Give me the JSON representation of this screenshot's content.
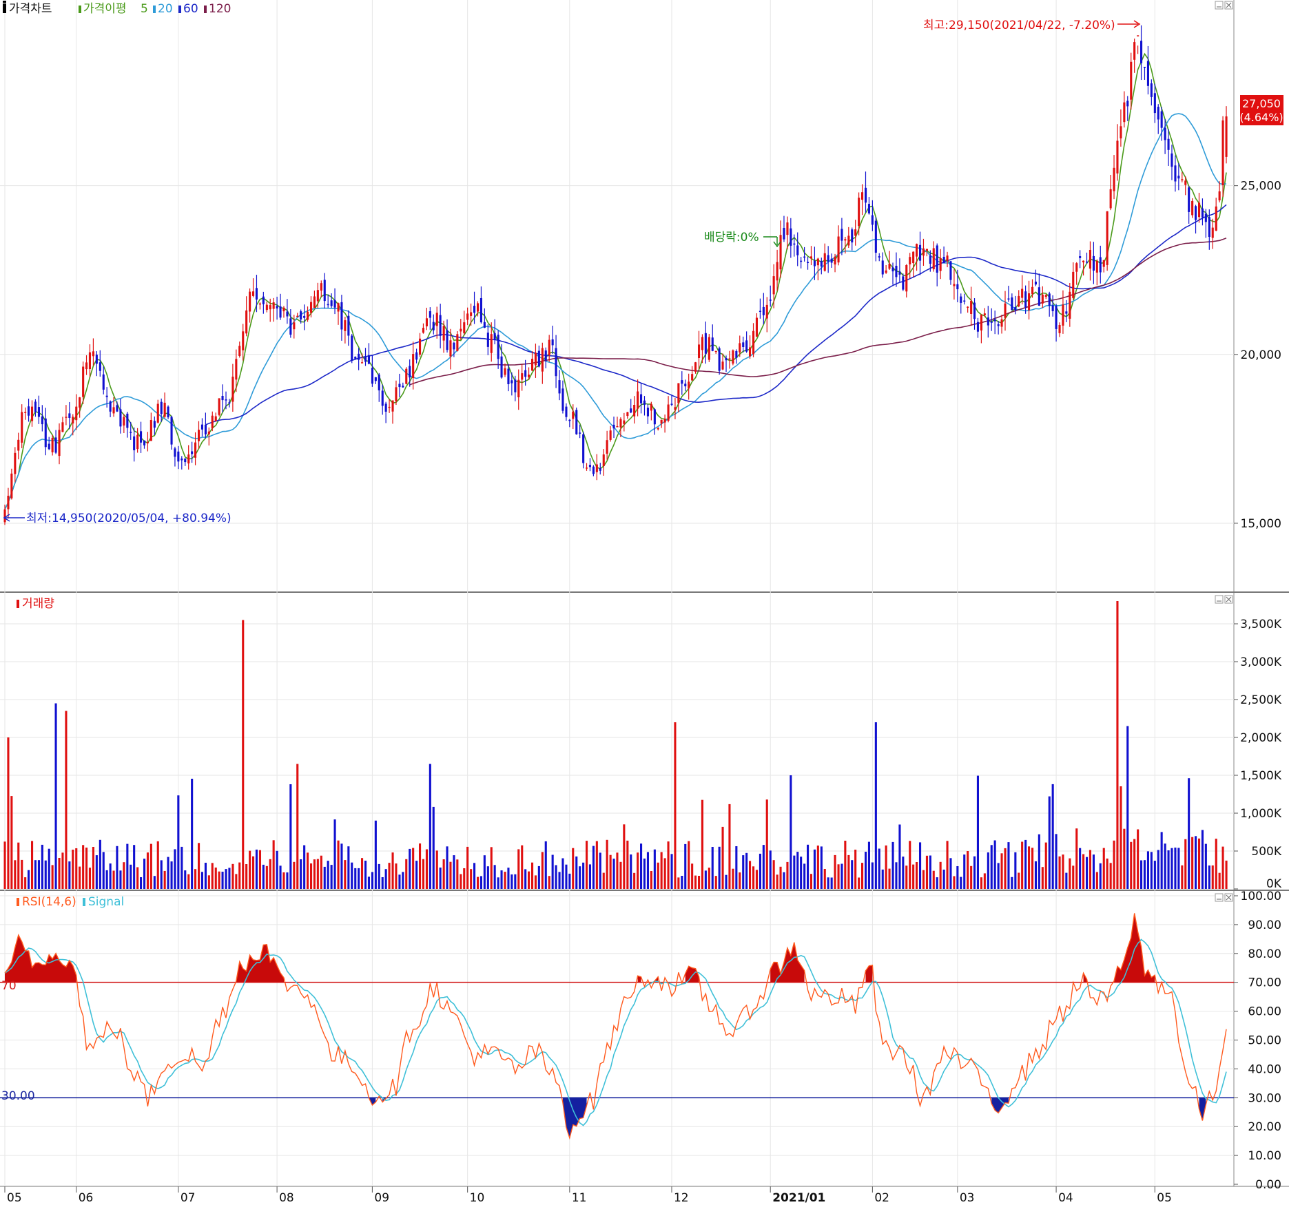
{
  "price_panel": {
    "legend": {
      "title": "가격차트",
      "ma_label": "가격이평",
      "ma_periods": [
        "5",
        "20",
        "60",
        "120"
      ],
      "ma_colors": [
        "#4a9a1a",
        "#2e9bd8",
        "#1c28c8",
        "#7b1e4a"
      ]
    },
    "y_ticks": [
      "15,000",
      "20,000",
      "25,000"
    ],
    "current_price": "27,050",
    "current_change": "(4.64%)",
    "high_annotation": "최고:29,150(2021/04/22, -7.20%)",
    "low_annotation": "최저:14,950(2020/05/04, +80.94%)",
    "dividend_annotation": "배당락:0%",
    "colors": {
      "up": "#e01010",
      "down": "#1010d0"
    }
  },
  "volume_panel": {
    "legend": "거래량",
    "y_ticks": [
      "0K",
      "500K",
      "1,000K",
      "1,500K",
      "2,000K",
      "2,500K",
      "3,000K",
      "3,500K"
    ]
  },
  "rsi_panel": {
    "legend_rsi": "RSI(14,6)",
    "legend_signal": "Signal",
    "y_ticks": [
      "0.00",
      "10.00",
      "20.00",
      "30.00",
      "40.00",
      "50.00",
      "60.00",
      "70.00",
      "80.00",
      "90.00",
      "100.00"
    ],
    "upper_level_label": "70",
    "lower_level_label": "30.00",
    "colors": {
      "rsi": "#ff5a1e",
      "signal": "#3fc0d8",
      "upper": "#d21a1a",
      "lower": "#1c28a0"
    }
  },
  "x_axis": {
    "labels": [
      "05",
      "06",
      "07",
      "08",
      "09",
      "10",
      "11",
      "12",
      "2021/01",
      "02",
      "03",
      "04",
      "05"
    ]
  },
  "chart_data": [
    {
      "type": "candlestick",
      "title": "가격차트",
      "x_months": [
        "2020/05",
        "2020/06",
        "2020/07",
        "2020/08",
        "2020/09",
        "2020/10",
        "2020/11",
        "2020/12",
        "2021/01",
        "2021/02",
        "2021/03",
        "2021/04",
        "2021/05"
      ],
      "ylim": [
        13000,
        30500
      ],
      "control_points_close": [
        [
          0,
          15500
        ],
        [
          6,
          18400
        ],
        [
          14,
          17300
        ],
        [
          20,
          18400
        ],
        [
          25,
          20200
        ],
        [
          32,
          18200
        ],
        [
          40,
          17300
        ],
        [
          46,
          18400
        ],
        [
          52,
          16800
        ],
        [
          58,
          17600
        ],
        [
          66,
          18800
        ],
        [
          72,
          21700
        ],
        [
          78,
          21500
        ],
        [
          85,
          20800
        ],
        [
          92,
          21800
        ],
        [
          98,
          21200
        ],
        [
          104,
          19800
        ],
        [
          112,
          18600
        ],
        [
          118,
          19400
        ],
        [
          125,
          21100
        ],
        [
          131,
          20300
        ],
        [
          137,
          21500
        ],
        [
          143,
          20300
        ],
        [
          149,
          19000
        ],
        [
          154,
          19700
        ],
        [
          160,
          20200
        ],
        [
          166,
          18100
        ],
        [
          173,
          16400
        ],
        [
          180,
          17900
        ],
        [
          186,
          18600
        ],
        [
          193,
          18100
        ],
        [
          199,
          19000
        ],
        [
          205,
          20400
        ],
        [
          211,
          19800
        ],
        [
          217,
          20200
        ],
        [
          223,
          21400
        ],
        [
          229,
          23700
        ],
        [
          235,
          22600
        ],
        [
          241,
          22700
        ],
        [
          247,
          23300
        ],
        [
          252,
          24500
        ],
        [
          258,
          22500
        ],
        [
          264,
          22300
        ],
        [
          270,
          23100
        ],
        [
          276,
          22700
        ],
        [
          282,
          21600
        ],
        [
          286,
          20900
        ],
        [
          292,
          21000
        ],
        [
          298,
          21600
        ],
        [
          304,
          21700
        ],
        [
          310,
          21000
        ],
        [
          316,
          23000
        ],
        [
          322,
          22800
        ],
        [
          328,
          27000
        ],
        [
          333,
          29150
        ],
        [
          339,
          27300
        ],
        [
          345,
          25000
        ],
        [
          350,
          24200
        ],
        [
          355,
          23400
        ],
        [
          359,
          27050
        ]
      ],
      "ma_series": [
        "MA5",
        "MA20",
        "MA60",
        "MA120"
      ],
      "last_close": 27050,
      "high": {
        "date": "2021/04/22",
        "value": 29150
      },
      "low": {
        "date": "2020/05/04",
        "value": 14950
      }
    },
    {
      "type": "bar",
      "title": "거래량",
      "ylim": [
        0,
        3900000
      ],
      "spikes": [
        [
          1,
          2000000
        ],
        [
          15,
          2450000
        ],
        [
          18,
          2350000
        ],
        [
          70,
          3550000
        ],
        [
          86,
          1650000
        ],
        [
          125,
          1650000
        ],
        [
          197,
          2200000
        ],
        [
          231,
          1500000
        ],
        [
          256,
          2200000
        ],
        [
          327,
          3800000
        ],
        [
          330,
          2150000
        ]
      ]
    },
    {
      "type": "line",
      "title": "RSI(14,6)",
      "ylim": [
        0,
        100
      ],
      "levels": [
        70,
        30
      ],
      "control_points": [
        [
          0,
          70
        ],
        [
          4,
          83
        ],
        [
          10,
          76
        ],
        [
          15,
          82
        ],
        [
          20,
          75
        ],
        [
          25,
          47
        ],
        [
          32,
          55
        ],
        [
          38,
          38
        ],
        [
          42,
          30
        ],
        [
          48,
          43
        ],
        [
          54,
          45
        ],
        [
          58,
          40
        ],
        [
          64,
          60
        ],
        [
          70,
          77
        ],
        [
          76,
          82
        ],
        [
          82,
          70
        ],
        [
          90,
          65
        ],
        [
          96,
          45
        ],
        [
          103,
          41
        ],
        [
          108,
          30
        ],
        [
          114,
          33
        ],
        [
          120,
          55
        ],
        [
          126,
          68
        ],
        [
          132,
          58
        ],
        [
          138,
          45
        ],
        [
          144,
          45
        ],
        [
          150,
          40
        ],
        [
          156,
          46
        ],
        [
          162,
          36
        ],
        [
          166,
          20
        ],
        [
          172,
          28
        ],
        [
          178,
          50
        ],
        [
          184,
          68
        ],
        [
          190,
          72
        ],
        [
          196,
          69
        ],
        [
          202,
          72
        ],
        [
          208,
          61
        ],
        [
          214,
          52
        ],
        [
          220,
          62
        ],
        [
          226,
          74
        ],
        [
          232,
          82
        ],
        [
          238,
          65
        ],
        [
          244,
          65
        ],
        [
          250,
          62
        ],
        [
          254,
          77
        ],
        [
          258,
          48
        ],
        [
          264,
          45
        ],
        [
          270,
          30
        ],
        [
          276,
          45
        ],
        [
          282,
          42
        ],
        [
          288,
          34
        ],
        [
          292,
          27
        ],
        [
          298,
          37
        ],
        [
          304,
          47
        ],
        [
          310,
          59
        ],
        [
          316,
          70
        ],
        [
          322,
          63
        ],
        [
          328,
          73
        ],
        [
          332,
          91
        ],
        [
          336,
          72
        ],
        [
          342,
          68
        ],
        [
          348,
          35
        ],
        [
          352,
          25
        ],
        [
          356,
          32
        ],
        [
          359,
          56
        ]
      ]
    }
  ]
}
